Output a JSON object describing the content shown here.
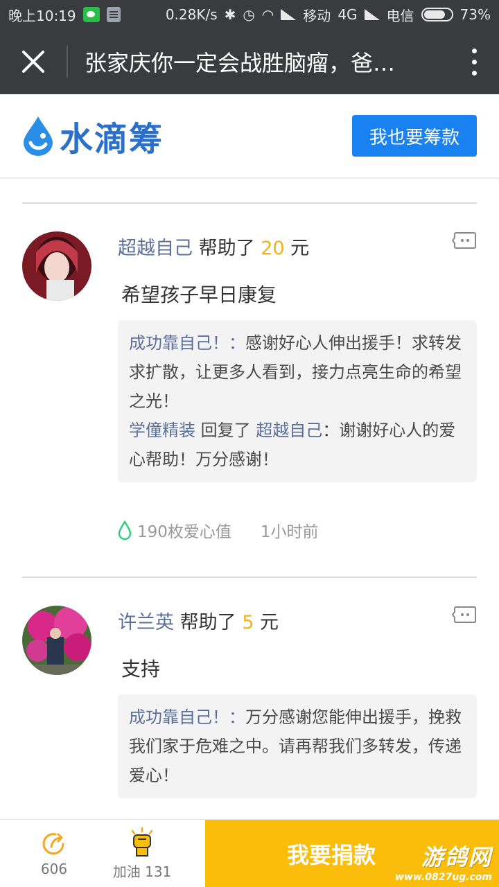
{
  "status_bar": {
    "time": "晚上10:19",
    "speed": "0.28K/s",
    "carrier1": "移动",
    "network": "4G",
    "carrier2": "电信",
    "battery": "73%"
  },
  "title_bar": {
    "title": "张家庆你一定会战胜脑瘤，爸…"
  },
  "brand": {
    "logo_text": "水滴筹",
    "cta": "我也要筹款",
    "color": "#1a82f0"
  },
  "entries": [
    {
      "donor": "超越自己",
      "helped": "帮助了",
      "amount": "20",
      "unit": "元",
      "message": "希望孩子早日康复",
      "replies": [
        {
          "name": "成功靠自己！：",
          "text": "感谢好心人伸出援手！求转发求扩散，让更多人看到，接力点亮生命的希望之光！"
        },
        {
          "name": "学僮精装",
          "mid": " 回复了 ",
          "target": "超越自己",
          "text": "：谢谢好心人的爱心帮助！万分感谢！"
        }
      ],
      "points": "190枚爱心值",
      "time": "1小时前"
    },
    {
      "donor": "许兰英",
      "helped": "帮助了",
      "amount": "5",
      "unit": "元",
      "message": "支持",
      "replies": [
        {
          "name": "成功靠自己！：",
          "text": "万分感谢您能伸出援手，挽救我们家于危难之中。请再帮我们多转发，传递爱心！"
        }
      ]
    }
  ],
  "bottom_bar": {
    "share_count": "606",
    "cheer_label": "加油 131",
    "donate_label": "我要捐款",
    "watermark_big": "游鸽网",
    "watermark_small": "www.0827ug.com"
  }
}
